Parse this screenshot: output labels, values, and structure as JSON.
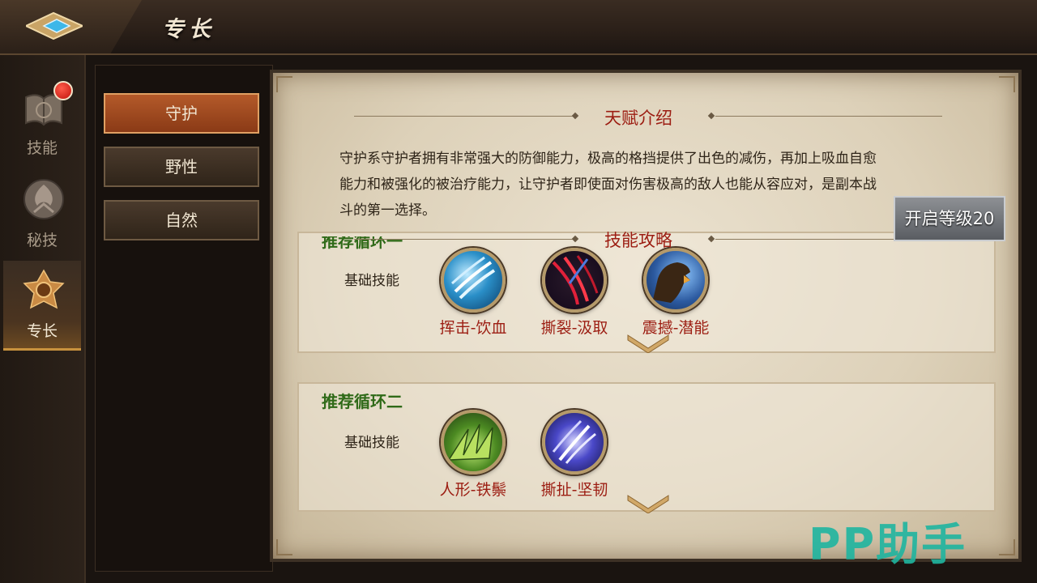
{
  "header": {
    "title": "专长"
  },
  "leftnav": {
    "items": [
      {
        "label": "技能",
        "has_badge": true
      },
      {
        "label": "秘技",
        "has_badge": false
      },
      {
        "label": "专长",
        "has_badge": false,
        "active": true
      }
    ]
  },
  "subtabs": {
    "items": [
      {
        "label": "守护",
        "active": true
      },
      {
        "label": "野性",
        "active": false
      },
      {
        "label": "自然",
        "active": false
      }
    ]
  },
  "talent": {
    "title": "天赋介绍",
    "desc_line1": "守护系守护者拥有非常强大的防御能力，极高的格挡提供了出色的减伤，再加上吸血自愈",
    "desc_line2": "能力和被强化的被治疗能力，让守护者即使面对伤害极高的敌人也能从容应对，是副本战",
    "desc_line3": "斗的第一选择。"
  },
  "guide": {
    "title": "技能攻略"
  },
  "rotations": [
    {
      "title": "推荐循环一",
      "basic_label": "基础技能",
      "skills": [
        {
          "name": "挥击-饮血"
        },
        {
          "name": "撕裂-汲取"
        },
        {
          "name": "震撼-潜能"
        }
      ]
    },
    {
      "title": "推荐循环二",
      "basic_label": "基础技能",
      "skills": [
        {
          "name": "人形-铁鬃"
        },
        {
          "name": "撕扯-坚韧"
        }
      ]
    }
  ],
  "unlock": {
    "label": "开启等级20"
  },
  "watermark": {
    "text": "PP助手"
  },
  "colors": {
    "accent_red": "#9c1d12",
    "rotation_green": "#2f6a18",
    "active_tab": "#b45a2a"
  }
}
